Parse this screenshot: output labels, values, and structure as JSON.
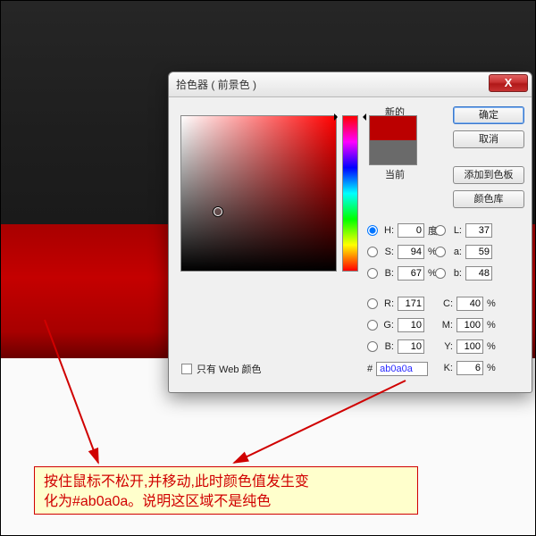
{
  "dialog": {
    "title": "拾色器 ( 前景色 )",
    "close_label": "X",
    "new_label": "新的",
    "current_label": "当前",
    "buttons": {
      "ok": "确定",
      "cancel": "取消",
      "add": "添加到色板",
      "library": "颜色库"
    },
    "hsb": {
      "h_label": "H:",
      "h_value": "0",
      "h_unit": "度",
      "s_label": "S:",
      "s_value": "94",
      "s_unit": "%",
      "b_label": "B:",
      "b_value": "67",
      "b_unit": "%"
    },
    "lab": {
      "l_label": "L:",
      "l_value": "37",
      "a_label": "a:",
      "a_value": "59",
      "b_label": "b:",
      "b_value": "48"
    },
    "rgb": {
      "r_label": "R:",
      "r_value": "171",
      "g_label": "G:",
      "g_value": "10",
      "b_label": "B:",
      "b_value": "10"
    },
    "cmyk": {
      "c_label": "C:",
      "c_value": "40",
      "c_unit": "%",
      "m_label": "M:",
      "m_value": "100",
      "m_unit": "%",
      "y_label": "Y:",
      "y_value": "100",
      "y_unit": "%",
      "k_label": "K:",
      "k_value": "6",
      "k_unit": "%"
    },
    "web_only_label": "只有 Web 颜色",
    "hex_prefix": "#",
    "hex_value": "ab0a0a",
    "swatch": {
      "new_color": "#bb0000",
      "current_color": "#6a6a6a"
    }
  },
  "annotation": {
    "line1": "按住鼠标不松开,并移动,此时颜色值发生变",
    "line2": "化为#ab0a0a。说明这区域不是纯色"
  }
}
